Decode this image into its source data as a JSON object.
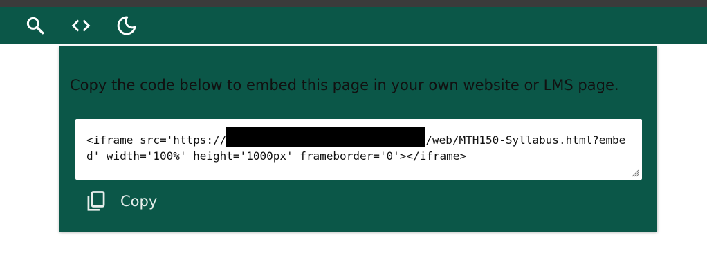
{
  "toolbar": {
    "search_icon": "search-icon",
    "code_icon": "code-icon",
    "theme_icon": "moon-icon",
    "background": "#0b5748"
  },
  "embed_dialog": {
    "prompt": "Copy the code below to embed this page in your own website or LMS page.",
    "code_prefix": "<iframe src='https://",
    "code_suffix": "/web/MTH150-Syllabus.html?embed' width='100%' height='1000px' frameborder='0'></iframe>",
    "copy_label": "Copy",
    "copy_icon": "copy-icon"
  },
  "colors": {
    "panel": "#0b5748",
    "text_light": "#e8efec"
  }
}
